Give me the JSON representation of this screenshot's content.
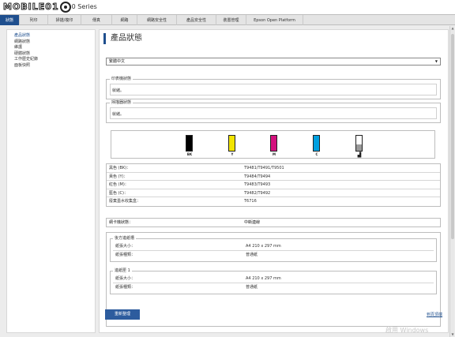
{
  "header": {
    "logo_text": "MOBILE01",
    "series_text": "0 Series"
  },
  "tabs": [
    {
      "label": "狀態"
    },
    {
      "label": "列印"
    },
    {
      "label": "掃描/複印"
    },
    {
      "label": "傳真"
    },
    {
      "label": "網路"
    },
    {
      "label": "網路安全性"
    },
    {
      "label": "產品安全性"
    },
    {
      "label": "裝置管理"
    },
    {
      "label": "Epson Open Platform"
    }
  ],
  "sidebar": {
    "items": [
      {
        "label": "產品狀態"
      },
      {
        "label": "網路狀態"
      },
      {
        "label": "維護"
      },
      {
        "label": "硬體狀態"
      },
      {
        "label": "工作歷史紀錄"
      },
      {
        "label": "面板快照"
      }
    ]
  },
  "main": {
    "title": "產品狀態",
    "language_select": "繁體中文",
    "printer_status": {
      "legend": "印表機狀態",
      "value": "就緒。"
    },
    "scanner_status": {
      "legend": "掃描器狀態",
      "value": "就緒。"
    },
    "ink_levels": [
      {
        "label": "BK",
        "color": "#000000",
        "level": 1.0
      },
      {
        "label": "Y",
        "color": "#f2e400",
        "level": 1.0
      },
      {
        "label": "M",
        "color": "#d4127e",
        "level": 1.0
      },
      {
        "label": "C",
        "color": "#00a0e0",
        "level": 1.0
      }
    ],
    "maintenance_box": {
      "level": 0.4
    },
    "cartridges": [
      {
        "key": "黑色 (BK)：",
        "value": "T9481/T9491/T9501"
      },
      {
        "key": "黃色 (Y)：",
        "value": "T9484/T9494"
      },
      {
        "key": "紅色 (M)：",
        "value": "T9483/T9493"
      },
      {
        "key": "藍色 (C)：",
        "value": "T9482/T9492"
      },
      {
        "key": "廢棄墨水收集盒：",
        "value": "T6716"
      }
    ],
    "network_status": {
      "key": "網卡機狀態：",
      "value": "中斷連線"
    },
    "trays": [
      {
        "legend": "後方進紙槽",
        "rows": [
          {
            "key": "紙張大小：",
            "value": "A4 210 x 297 mm"
          },
          {
            "key": "紙張種類：",
            "value": "普通紙"
          }
        ]
      },
      {
        "legend": "進紙匣 1",
        "rows": [
          {
            "key": "紙張大小：",
            "value": "A4 210 x 297 mm"
          },
          {
            "key": "紙張種類：",
            "value": "普通紙"
          }
        ]
      }
    ],
    "refresh_button": "重新整理",
    "top_link": "到頁頂端"
  },
  "watermark": "啟用 Windows"
}
